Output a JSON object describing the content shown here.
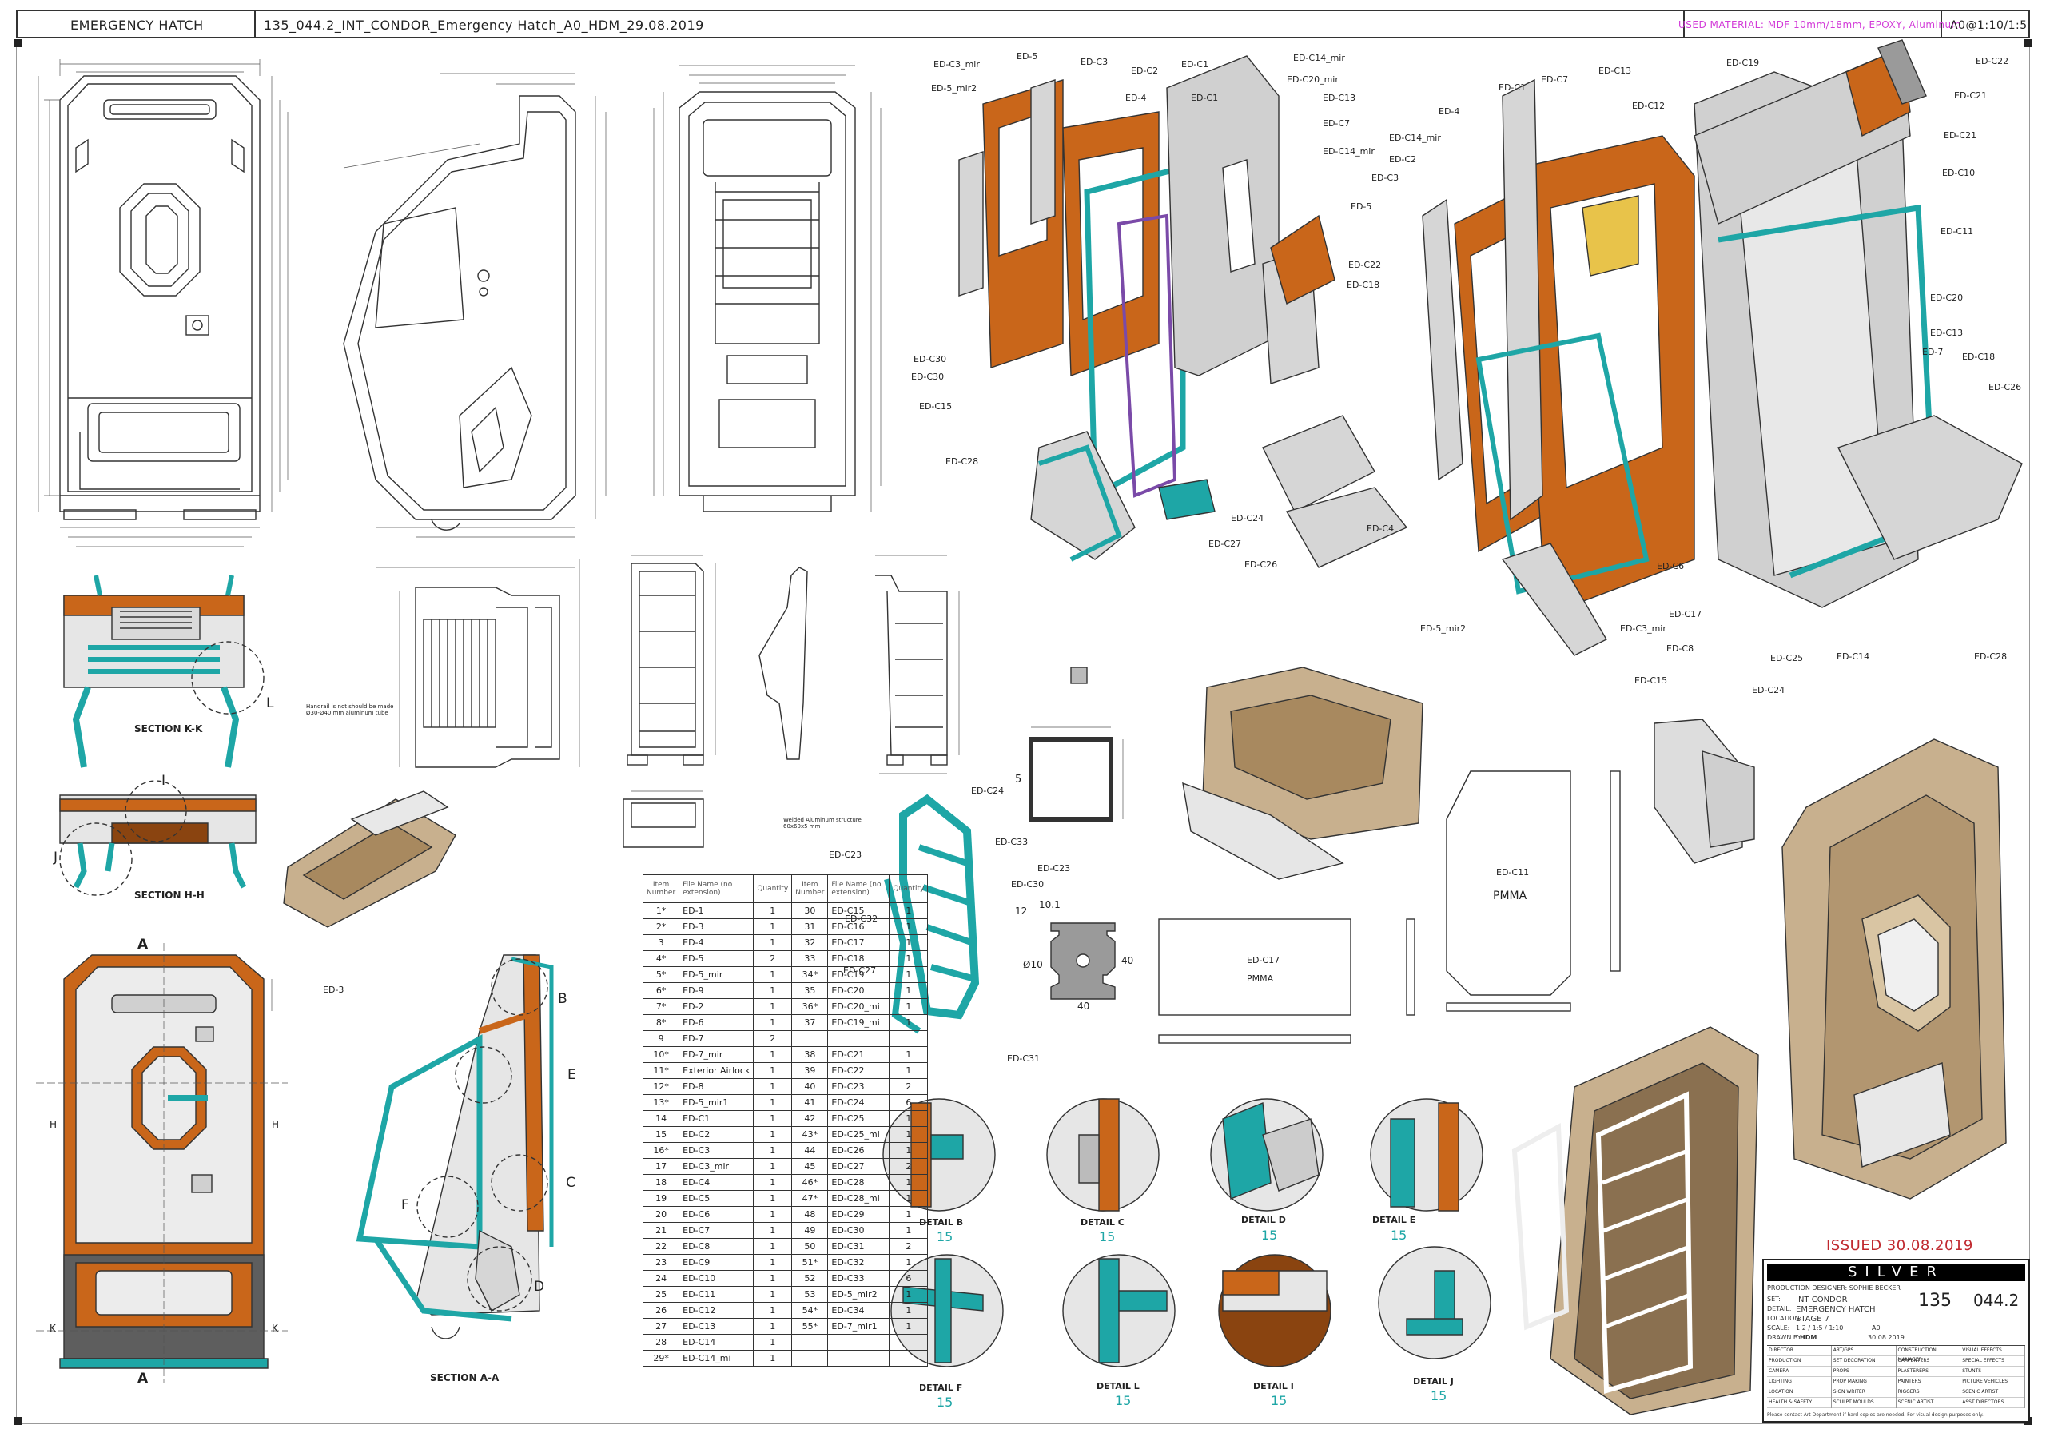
{
  "header": {
    "title": "EMERGENCY HATCH",
    "filename": "135_044.2_INT_CONDOR_Emergency Hatch_A0_HDM_29.08.2019",
    "material": "USED MATERIAL: MDF 10mm/18mm, EPOXY, Aluminum",
    "scale": "A0@1:10/1:5",
    "material_color": "#d23ad8"
  },
  "colors": {
    "orange": "#c9661a",
    "teal": "#1ea6a6",
    "grey": "#cfcfcf",
    "tan": "#c8b08e",
    "line": "#333333",
    "red": "#c0282e"
  },
  "exploded_left_labels": [
    "ED-C3_mir",
    "ED-5_mir2",
    "ED-5",
    "ED-C3",
    "ED-C2",
    "ED-4",
    "ED-C1",
    "ED-C1",
    "ED-C14_mir",
    "ED-C20_mir",
    "ED-C13",
    "ED-C7",
    "ED-C14_mir",
    "ED-5",
    "ED-C22",
    "ED-C18",
    "ED-C30",
    "ED-C30",
    "ED-C15",
    "ED-C28",
    "ED-C24",
    "ED-C27",
    "ED-C26"
  ],
  "exploded_right_labels": [
    "ED-C13",
    "ED-C19",
    "ED-C22",
    "ED-C1",
    "ED-C7",
    "ED-C12",
    "ED-C21",
    "ED-4",
    "ED-C21",
    "ED-C14_mir",
    "ED-C10",
    "ED-C2",
    "ED-C3",
    "ED-C11",
    "ED-C20",
    "ED-C13",
    "ED-7",
    "ED-C18",
    "ED-C26",
    "ED-C4",
    "ED-C6",
    "ED-C17",
    "ED-5_mir2",
    "ED-C3_mir",
    "ED-C8",
    "ED-C25",
    "ED-C14",
    "ED-C28",
    "ED-C15",
    "ED-C24"
  ],
  "sections": {
    "kk": "SECTION K-K",
    "hh": "SECTION H-H",
    "aa": "SECTION A-A",
    "handrail_note": "Handrail is not should be made\nØ30-Ø40 mm aluminum tube",
    "welded_note": "Welded Aluminum structure\n60x60x5 mm"
  },
  "letters": {
    "L": "L",
    "I": "I",
    "J": "J",
    "A": "A",
    "H": "H",
    "K": "K",
    "B": "B",
    "E": "E",
    "C": "C",
    "F": "F",
    "D": "D"
  },
  "callouts": {
    "ed3": "ED-3",
    "ed_c24": "ED-C24",
    "ed_c33": "ED-C33",
    "ed_c23": "ED-C23",
    "ed_c30": "ED-C30",
    "ed_c32": "ED-C32",
    "ed_c27": "ED-C27",
    "ed_c31": "ED-C31",
    "ed_c23b": "ED-C23",
    "ed_c11": "ED-C11",
    "pmma": "PMMA",
    "ed_c17": "ED-C17",
    "pmma2": "PMMA"
  },
  "profile": {
    "five": "5",
    "d10": "Ø10",
    "w101": "10.1",
    "w40": "40",
    "h40": "40",
    "h12": "12"
  },
  "details": [
    {
      "name": "DETAIL B",
      "scale": "15"
    },
    {
      "name": "DETAIL C",
      "scale": "15"
    },
    {
      "name": "DETAIL D",
      "scale": "15"
    },
    {
      "name": "DETAIL E",
      "scale": "15"
    },
    {
      "name": "DETAIL F",
      "scale": "15"
    },
    {
      "name": "DETAIL L",
      "scale": "15"
    },
    {
      "name": "DETAIL I",
      "scale": "15"
    },
    {
      "name": "DETAIL J",
      "scale": "15"
    }
  ],
  "table": {
    "head": [
      "Item\nNumber",
      "File Name (no\nextension)",
      "Quantity",
      "Item\nNumber",
      "File Name (no\nextension)",
      "Quantity"
    ],
    "rows": [
      [
        "1*",
        "ED-1",
        "1",
        "30",
        "ED-C15",
        "1"
      ],
      [
        "2*",
        "ED-3",
        "1",
        "31",
        "ED-C16",
        "1"
      ],
      [
        "3",
        "ED-4",
        "1",
        "32",
        "ED-C17",
        "1"
      ],
      [
        "4*",
        "ED-5",
        "2",
        "33",
        "ED-C18",
        "1"
      ],
      [
        "5*",
        "ED-5_mir",
        "1",
        "34*",
        "ED-C19",
        "1"
      ],
      [
        "6*",
        "ED-9",
        "1",
        "35",
        "ED-C20",
        "1"
      ],
      [
        "7*",
        "ED-2",
        "1",
        "36*",
        "ED-C20_mi",
        "1"
      ],
      [
        "8*",
        "ED-6",
        "1",
        "37",
        "ED-C19_mi",
        "1"
      ],
      [
        "9",
        "ED-7",
        "2",
        "",
        "",
        ""
      ],
      [
        "10*",
        "ED-7_mir",
        "1",
        "38",
        "ED-C21",
        "1"
      ],
      [
        "11*",
        "Exterior Airlock",
        "1",
        "39",
        "ED-C22",
        "1"
      ],
      [
        "12*",
        "ED-8",
        "1",
        "40",
        "ED-C23",
        "2"
      ],
      [
        "13*",
        "ED-5_mir1",
        "1",
        "41",
        "ED-C24",
        "6"
      ],
      [
        "14",
        "ED-C1",
        "1",
        "42",
        "ED-C25",
        "1"
      ],
      [
        "15",
        "ED-C2",
        "1",
        "43*",
        "ED-C25_mi",
        "1"
      ],
      [
        "16*",
        "ED-C3",
        "1",
        "44",
        "ED-C26",
        "1"
      ],
      [
        "17",
        "ED-C3_mir",
        "1",
        "45",
        "ED-C27",
        "2"
      ],
      [
        "18",
        "ED-C4",
        "1",
        "46*",
        "ED-C28",
        "1"
      ],
      [
        "19",
        "ED-C5",
        "1",
        "47*",
        "ED-C28_mi",
        "1"
      ],
      [
        "20",
        "ED-C6",
        "1",
        "48",
        "ED-C29",
        "1"
      ],
      [
        "21",
        "ED-C7",
        "1",
        "49",
        "ED-C30",
        "1"
      ],
      [
        "22",
        "ED-C8",
        "1",
        "50",
        "ED-C31",
        "2"
      ],
      [
        "23",
        "ED-C9",
        "1",
        "51*",
        "ED-C32",
        "1"
      ],
      [
        "24",
        "ED-C10",
        "1",
        "52",
        "ED-C33",
        "6"
      ],
      [
        "25",
        "ED-C11",
        "1",
        "53",
        "ED-5_mir2",
        "1"
      ],
      [
        "26",
        "ED-C12",
        "1",
        "54*",
        "ED-C34",
        "1"
      ],
      [
        "27",
        "ED-C13",
        "1",
        "55*",
        "ED-7_mir1",
        "1"
      ],
      [
        "28",
        "ED-C14",
        "1",
        "",
        "",
        ""
      ],
      [
        "29*",
        "ED-C14_mi",
        "1",
        "",
        "",
        ""
      ]
    ]
  },
  "title_block": {
    "issued": "ISSUED 30.08.2019",
    "brand": "SILVER",
    "designer": "PRODUCTION DESIGNER: SOPHIE BECKER",
    "set": "INT CONDOR",
    "detail": "EMERGENCY HATCH",
    "location": "STAGE 7",
    "scale": "1:2 / 1:5 / 1:10",
    "print_size": "A0",
    "drawn_by": "HDM",
    "date_drawn": "30.08.2019",
    "set_no": "135",
    "dwg_no": "044.2",
    "footer": "Please contact Art Department if hard copies are needed. For visual design purposes only.",
    "dept_left": [
      "DIRECTOR",
      "PRODUCTION",
      "CAMERA",
      "LIGHTING",
      "LOCATION",
      "HEALTH & SAFETY"
    ],
    "dept_mid": [
      "ART/GPS",
      "SET DECORATION",
      "PROPS",
      "PROP MAKING",
      "SIGN WRITER",
      "SCULPT MOULDS"
    ],
    "dept_right": [
      "CONSTRUCTION MANAGER",
      "CARPENTERS",
      "PLASTERERS",
      "PAINTERS",
      "RIGGERS",
      "SCENIC ARTIST"
    ],
    "dept_far": [
      "VISUAL EFFECTS",
      "SPECIAL EFFECTS",
      "STUNTS",
      "PICTURE VEHICLES",
      "SCENIC ARTIST",
      "ASST DIRECTORS"
    ]
  }
}
